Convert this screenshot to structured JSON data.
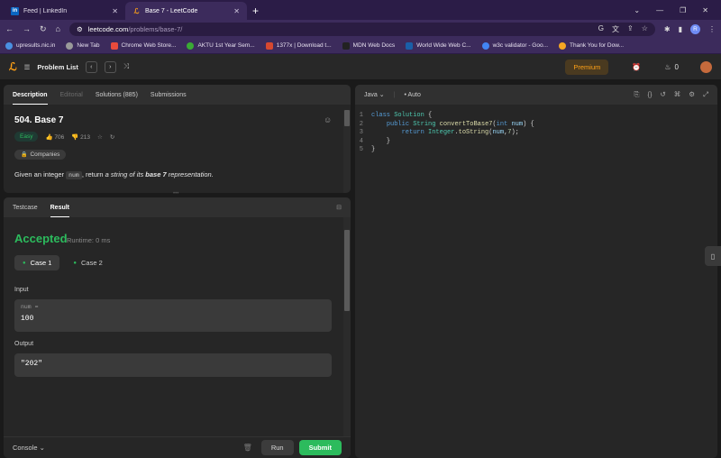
{
  "browser": {
    "tabs": [
      {
        "title": "Feed | LinkedIn",
        "favicon": "linkedin-icon",
        "active": false
      },
      {
        "title": "Base 7 - LeetCode",
        "favicon": "leetcode-icon",
        "active": true
      }
    ],
    "url_host": "leetcode.com",
    "url_path": "/problems/base-7/",
    "profile_initial": "R",
    "bookmarks": [
      {
        "label": "upresults.nic.in",
        "color": "#4a90e2"
      },
      {
        "label": "New Tab",
        "color": "#9a9a9a"
      },
      {
        "label": "Chrome Web Store...",
        "color": "#e94b3c"
      },
      {
        "label": "AKTU 1st Year Sem...",
        "color": "#3aaa35"
      },
      {
        "label": "1377x | Download t...",
        "color": "#d64830"
      },
      {
        "label": "MDN Web Docs",
        "color": "#222222"
      },
      {
        "label": "World Wide Web C...",
        "color": "#1a5fa8"
      },
      {
        "label": "w3c validator - Goo...",
        "color": "#4285f4"
      },
      {
        "label": "Thank You for Dow...",
        "color": "#f5a623"
      }
    ]
  },
  "nav": {
    "problem_list": "Problem List",
    "premium": "Premium",
    "streak": "0"
  },
  "description": {
    "tabs": [
      "Description",
      "Editorial",
      "Solutions (885)",
      "Submissions"
    ],
    "title": "504. Base 7",
    "difficulty": "Easy",
    "likes": "706",
    "dislikes": "213",
    "companies": "Companies",
    "statement_pre": "Given an integer ",
    "statement_code": "num",
    "statement_mid": ", return ",
    "statement_it": "a string of its ",
    "statement_bold": "base 7",
    "statement_end": " representation."
  },
  "result": {
    "tabs": [
      "Testcase",
      "Result"
    ],
    "status": "Accepted",
    "runtime": "Runtime: 0 ms",
    "cases": [
      "Case 1",
      "Case 2"
    ],
    "input_label": "Input",
    "input_var": "num =",
    "input_value": "100",
    "output_label": "Output",
    "output_value": "\"202\"",
    "console": "Console",
    "run": "Run",
    "submit": "Submit"
  },
  "editor": {
    "language": "Java",
    "mode": "Auto",
    "line_numbers": [
      "1",
      "2",
      "3",
      "4",
      "5"
    ]
  }
}
